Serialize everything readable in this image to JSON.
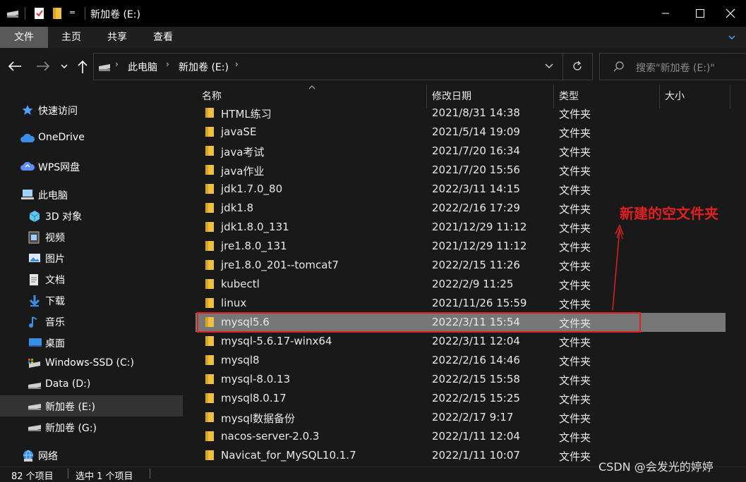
{
  "window": {
    "title": "新加卷 (E:)",
    "qat_dropdown": "="
  },
  "ribbon": {
    "tabs": [
      "文件",
      "主页",
      "共享",
      "查看"
    ]
  },
  "address": {
    "crumbs": [
      "此电脑",
      "新加卷 (E:)"
    ],
    "search_placeholder": "搜索\"新加卷 (E:)\""
  },
  "nav": {
    "items": [
      {
        "label": "快速访问",
        "icon": "star-icon"
      },
      {
        "label": "OneDrive",
        "icon": "cloud-icon"
      },
      {
        "label": "WPS网盘",
        "icon": "wps-cloud-icon"
      },
      {
        "label": "此电脑",
        "icon": "computer-icon"
      },
      {
        "label": "3D 对象",
        "icon": "cube-icon"
      },
      {
        "label": "视频",
        "icon": "video-icon"
      },
      {
        "label": "图片",
        "icon": "picture-icon"
      },
      {
        "label": "文档",
        "icon": "document-icon"
      },
      {
        "label": "下载",
        "icon": "download-icon"
      },
      {
        "label": "音乐",
        "icon": "music-icon"
      },
      {
        "label": "桌面",
        "icon": "desktop-icon"
      },
      {
        "label": "Windows-SSD (C:)",
        "icon": "drive-system-icon"
      },
      {
        "label": "Data (D:)",
        "icon": "drive-icon"
      },
      {
        "label": "新加卷 (E:)",
        "icon": "drive-icon"
      },
      {
        "label": "新加卷 (G:)",
        "icon": "drive-icon"
      },
      {
        "label": "网络",
        "icon": "network-icon"
      }
    ]
  },
  "columns": {
    "name": "名称",
    "date": "修改日期",
    "type": "类型",
    "size": "大小"
  },
  "files": [
    {
      "name": "HTML练习",
      "date": "2021/8/31 14:38",
      "type": "文件夹"
    },
    {
      "name": "javaSE",
      "date": "2021/5/14 19:09",
      "type": "文件夹"
    },
    {
      "name": "java考试",
      "date": "2021/7/20 16:34",
      "type": "文件夹"
    },
    {
      "name": "java作业",
      "date": "2021/7/20 15:56",
      "type": "文件夹"
    },
    {
      "name": "jdk1.7.0_80",
      "date": "2022/3/11 14:15",
      "type": "文件夹"
    },
    {
      "name": "jdk1.8",
      "date": "2022/2/16 17:29",
      "type": "文件夹"
    },
    {
      "name": "jdk1.8.0_131",
      "date": "2021/12/29 11:12",
      "type": "文件夹"
    },
    {
      "name": "jre1.8.0_131",
      "date": "2021/12/29 11:12",
      "type": "文件夹"
    },
    {
      "name": "jre1.8.0_201--tomcat7",
      "date": "2022/2/15 11:26",
      "type": "文件夹"
    },
    {
      "name": "kubectl",
      "date": "2022/2/9 11:25",
      "type": "文件夹"
    },
    {
      "name": "linux",
      "date": "2021/11/26 15:59",
      "type": "文件夹"
    },
    {
      "name": "mysql5.6",
      "date": "2022/3/11 15:54",
      "type": "文件夹"
    },
    {
      "name": "mysql-5.6.17-winx64",
      "date": "2022/3/11 12:04",
      "type": "文件夹"
    },
    {
      "name": "mysql8",
      "date": "2022/2/16 14:46",
      "type": "文件夹"
    },
    {
      "name": "mysql-8.0.13",
      "date": "2022/2/15 15:58",
      "type": "文件夹"
    },
    {
      "name": "mysql8.0.17",
      "date": "2022/2/15 15:25",
      "type": "文件夹"
    },
    {
      "name": "mysql数据备份",
      "date": "2022/2/17 9:17",
      "type": "文件夹"
    },
    {
      "name": "nacos-server-2.0.3",
      "date": "2022/1/11 12:04",
      "type": "文件夹"
    },
    {
      "name": "Navicat_for_MySQL10.1.7",
      "date": "2022/1/11 10:07",
      "type": "文件夹"
    }
  ],
  "selected_file": "mysql5.6",
  "annotation": {
    "text": "新建的空文件夹",
    "color": "#e02020"
  },
  "status": {
    "item_count": "82 个项目",
    "selected_count": "选中 1 个项目"
  },
  "watermark": "CSDN @会发光的婷婷",
  "colors": {
    "folder": "#f0c040",
    "selection": "#777777",
    "highlight_box": "#e02020",
    "accent": "#4aa3ff"
  }
}
